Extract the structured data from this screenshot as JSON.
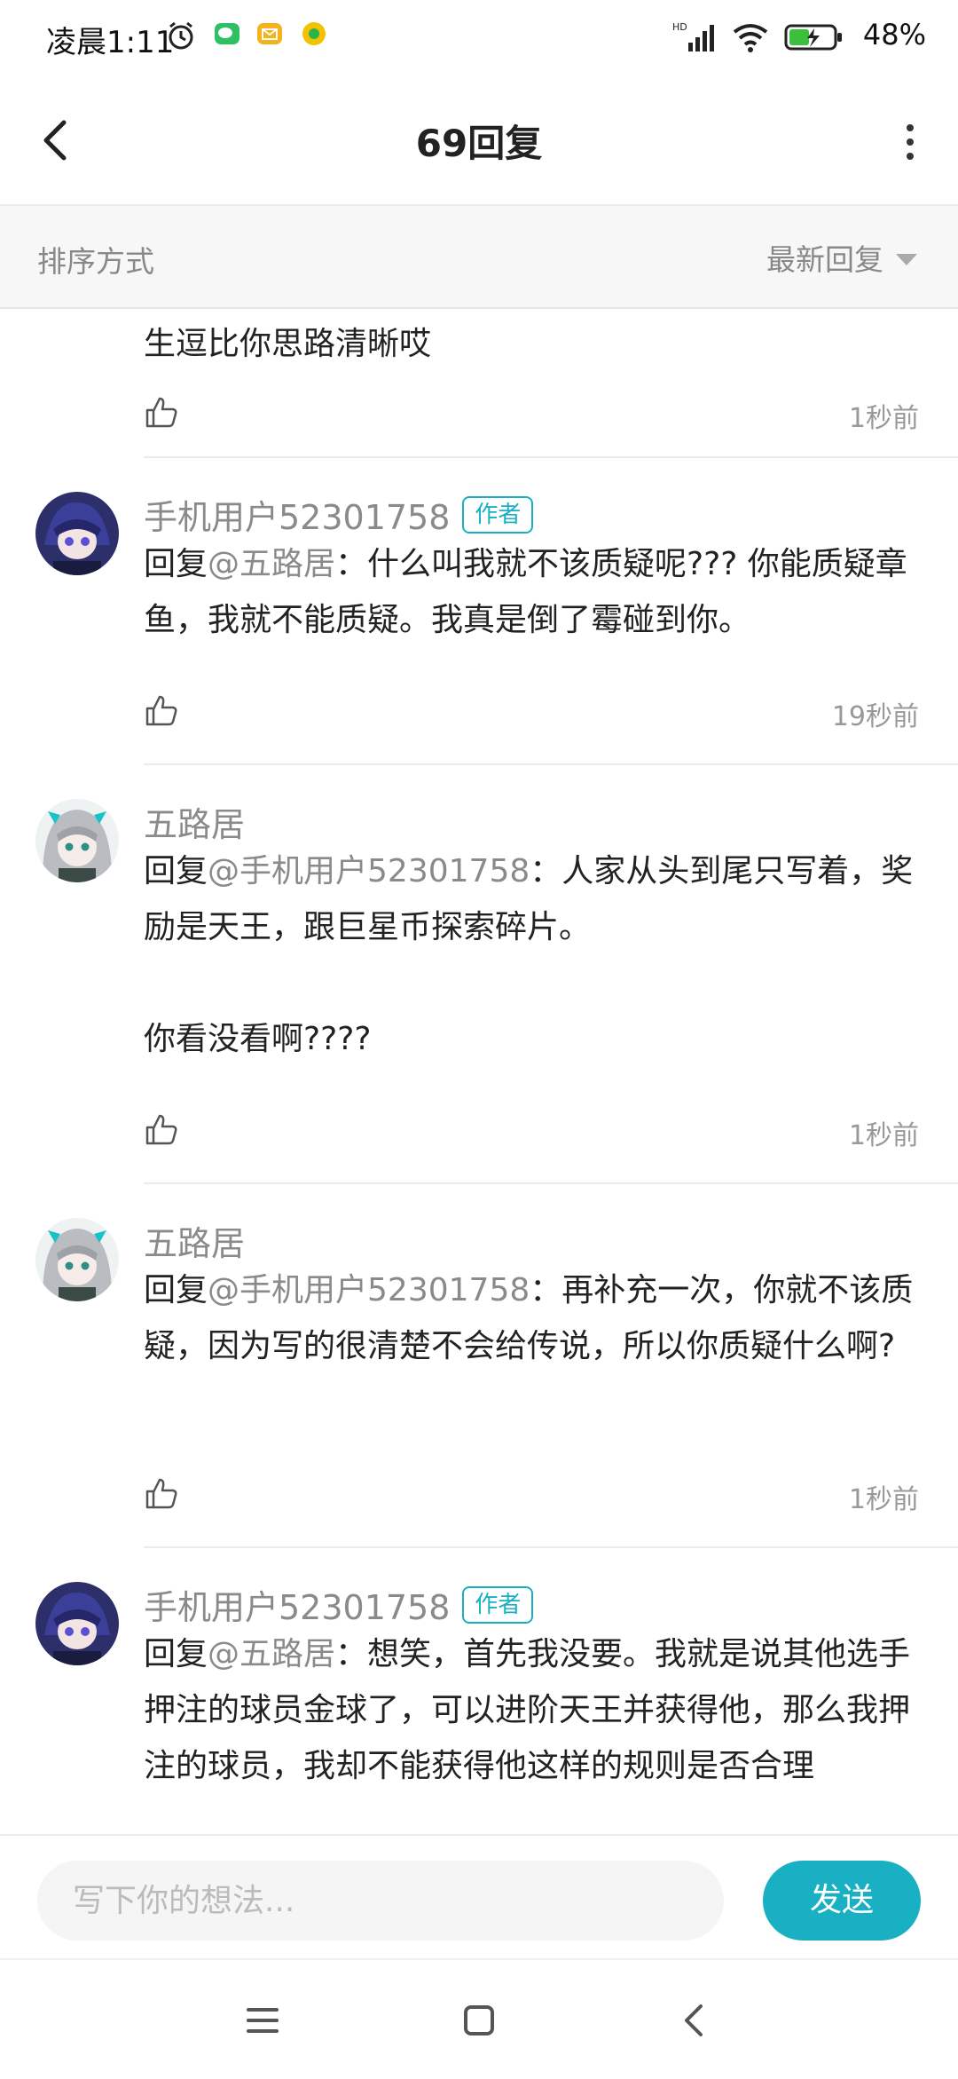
{
  "status_bar": {
    "time": "凌晨1:11",
    "battery": "48%",
    "network": "HD",
    "icons": [
      "alarm-icon",
      "wechat-icon",
      "mail-icon",
      "app-icon",
      "signal-icon",
      "wifi-icon",
      "battery-icon"
    ]
  },
  "header": {
    "title": "69回复"
  },
  "sort": {
    "label": "排序方式",
    "value": "最新回复"
  },
  "comments": [
    {
      "author": "",
      "badge": "",
      "body_prefix": "",
      "mention": "",
      "body": "生逗比你思路清晰哎",
      "time": "1秒前",
      "avatar": "none"
    },
    {
      "author": "手机用户52301758",
      "badge": "作者",
      "body_prefix": "回复",
      "mention": "@五路居",
      "body": "：什么叫我就不该质疑呢??? 你能质疑章鱼，我就不能质疑。我真是倒了霉碰到你。",
      "time": "19秒前",
      "avatar": "purple-anime-avatar"
    },
    {
      "author": "五路居",
      "badge": "",
      "body_prefix": "回复",
      "mention": "@手机用户52301758",
      "body": "：人家从头到尾只写着，奖励是天王，跟巨星币探索碎片。\n\n你看没看啊????",
      "time": "1秒前",
      "avatar": "silver-hair-anime-avatar"
    },
    {
      "author": "五路居",
      "badge": "",
      "body_prefix": "回复",
      "mention": "@手机用户52301758",
      "body": "：再补充一次，你就不该质疑，因为写的很清楚不会给传说，所以你质疑什么啊?",
      "time": "1秒前",
      "avatar": "silver-hair-anime-avatar"
    },
    {
      "author": "手机用户52301758",
      "badge": "作者",
      "body_prefix": "回复",
      "mention": "@五路居",
      "body": "：想笑，首先我没要。我就是说其他选手押注的球员金球了，可以进阶天王并获得他，那么我押注的球员，我却不能获得他这样的规则是否合理",
      "time": "",
      "avatar": "purple-anime-avatar"
    }
  ],
  "input_bar": {
    "placeholder": "写下你的想法...",
    "send_label": "发送"
  },
  "colors": {
    "accent": "#1ab0c4",
    "muted_text": "#8a8a8a",
    "body_text": "#222222"
  }
}
